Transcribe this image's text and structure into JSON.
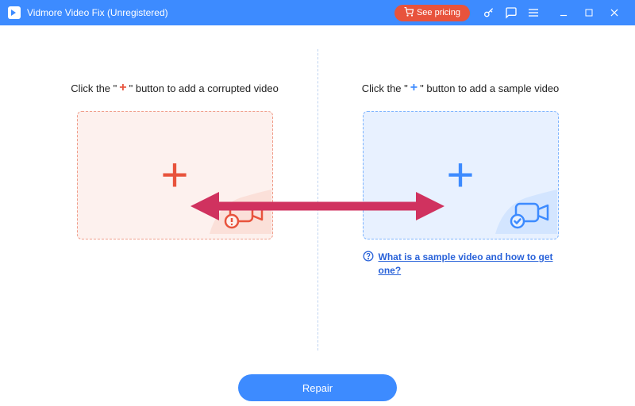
{
  "titlebar": {
    "app_name": "Vidmore Video Fix (Unregistered)",
    "pricing_label": "See pricing"
  },
  "panels": {
    "left": {
      "title_pre": "Click the \"",
      "title_post": "\" button to add a corrupted video"
    },
    "right": {
      "title_pre": "Click the \"",
      "title_post": "\" button to add a sample video",
      "help_text": "What is a sample video and how to get one?"
    }
  },
  "footer": {
    "repair_label": "Repair"
  },
  "colors": {
    "accent_blue": "#3d8bff",
    "accent_red": "#e8533c",
    "arrow_pink": "#d0325f"
  }
}
